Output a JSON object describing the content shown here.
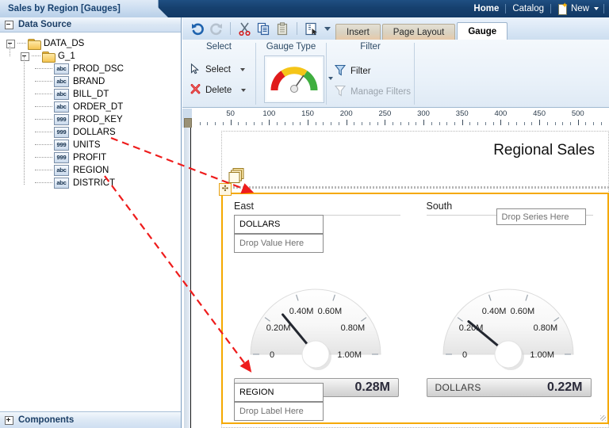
{
  "window": {
    "document_tab": "Sales by Region [Gauges]"
  },
  "topnav": {
    "home": "Home",
    "catalog": "Catalog",
    "new": "New",
    "new_icon": "new-page-icon",
    "caret_icon": "chevron-down-icon"
  },
  "left_panel": {
    "header": "Data Source",
    "header_toggle_icon": "collapse-minus-icon",
    "footer": "Components",
    "footer_toggle_icon": "expand-plus-icon",
    "tree": [
      {
        "label": "DATA_DS",
        "kind": "folder",
        "depth": 0,
        "toggle": "minus"
      },
      {
        "label": "G_1",
        "kind": "folder",
        "depth": 1,
        "toggle": "minus"
      },
      {
        "label": "PROD_DSC",
        "kind": "abc",
        "depth": 2
      },
      {
        "label": "BRAND",
        "kind": "abc",
        "depth": 2
      },
      {
        "label": "BILL_DT",
        "kind": "abc",
        "depth": 2
      },
      {
        "label": "ORDER_DT",
        "kind": "abc",
        "depth": 2
      },
      {
        "label": "PROD_KEY",
        "kind": "999",
        "depth": 2
      },
      {
        "label": "DOLLARS",
        "kind": "999",
        "depth": 2
      },
      {
        "label": "UNITS",
        "kind": "999",
        "depth": 2
      },
      {
        "label": "PROFIT",
        "kind": "999",
        "depth": 2
      },
      {
        "label": "REGION",
        "kind": "abc",
        "depth": 2
      },
      {
        "label": "DISTRICT",
        "kind": "abc",
        "depth": 2
      }
    ]
  },
  "quickbar": {
    "icons": [
      {
        "name": "undo-icon",
        "state": "enabled"
      },
      {
        "name": "redo-icon",
        "state": "disabled"
      },
      {
        "name": "cut-icon",
        "state": "enabled"
      },
      {
        "name": "copy-icon",
        "state": "enabled"
      },
      {
        "name": "paste-icon",
        "state": "enabled"
      },
      {
        "name": "select-all-icon",
        "state": "enabled"
      }
    ],
    "dropdown_icon": "chevron-down-icon"
  },
  "ribbon": {
    "tabs": [
      {
        "label": "Insert",
        "active": false
      },
      {
        "label": "Page Layout",
        "active": false
      },
      {
        "label": "Gauge",
        "active": true
      }
    ],
    "groups": [
      {
        "title": "Select",
        "items": [
          {
            "label": "Select",
            "icon": "cursor-arrow-icon",
            "enabled": true,
            "has_caret": true
          },
          {
            "label": "Delete",
            "icon": "red-x-icon",
            "enabled": true,
            "has_caret": true
          }
        ]
      },
      {
        "title": "Gauge Type",
        "items": [
          {
            "label": "",
            "icon": "gauge-dial-icon",
            "enabled": true,
            "has_caret": true
          }
        ]
      },
      {
        "title": "Filter",
        "items": [
          {
            "label": "Filter",
            "icon": "funnel-icon",
            "enabled": true,
            "has_caret": false
          },
          {
            "label": "Manage Filters",
            "icon": "funnel-outline-icon",
            "enabled": false,
            "has_caret": false
          }
        ]
      }
    ]
  },
  "ruler": {
    "ticks": [
      50,
      100,
      150,
      200,
      250,
      300,
      350,
      400,
      450,
      500
    ],
    "minor_step": 10
  },
  "canvas": {
    "report_title": "Regional Sales",
    "move_handle_icon": "move-cross-icon",
    "stack_icon": "stacked-pages-icon",
    "selection_color": "#f5a900",
    "resize_handle_icon": "resize-grip-icon",
    "regions": [
      {
        "name": "East",
        "series_drop": {
          "label": "Drop Series Here",
          "visible": false
        },
        "value_boxes": [
          {
            "label": "DOLLARS",
            "filled": true
          },
          {
            "label": "Drop Value Here",
            "filled": false
          }
        ],
        "label_boxes": [
          {
            "label": "REGION",
            "filled": true
          },
          {
            "label": "Drop Label Here",
            "filled": false
          }
        ],
        "gauge": {
          "series_label": "DOLLARS",
          "value_text": "0.28M",
          "value": 0.28,
          "min": 0,
          "max": 1.0,
          "needle_angle_deg": -56,
          "tick_labels": [
            "0",
            "0.20M",
            "0.40M",
            "0.60M",
            "0.80M",
            "1.00M"
          ]
        }
      },
      {
        "name": "South",
        "series_drop": {
          "label": "Drop Series Here",
          "visible": true
        },
        "value_boxes": [],
        "label_boxes": [],
        "gauge": {
          "series_label": "DOLLARS",
          "value_text": "0.22M",
          "value": 0.22,
          "min": 0,
          "max": 1.0,
          "needle_angle_deg": -68,
          "tick_labels": [
            "0",
            "0.20M",
            "0.40M",
            "0.60M",
            "0.80M",
            "1.00M"
          ]
        }
      }
    ]
  },
  "annotations": {
    "arrow_color": "#ee1c1c",
    "arrows": [
      {
        "from": "DOLLARS",
        "to": "East value drop zone"
      },
      {
        "from": "REGION",
        "to": "East label drop zone"
      }
    ]
  }
}
